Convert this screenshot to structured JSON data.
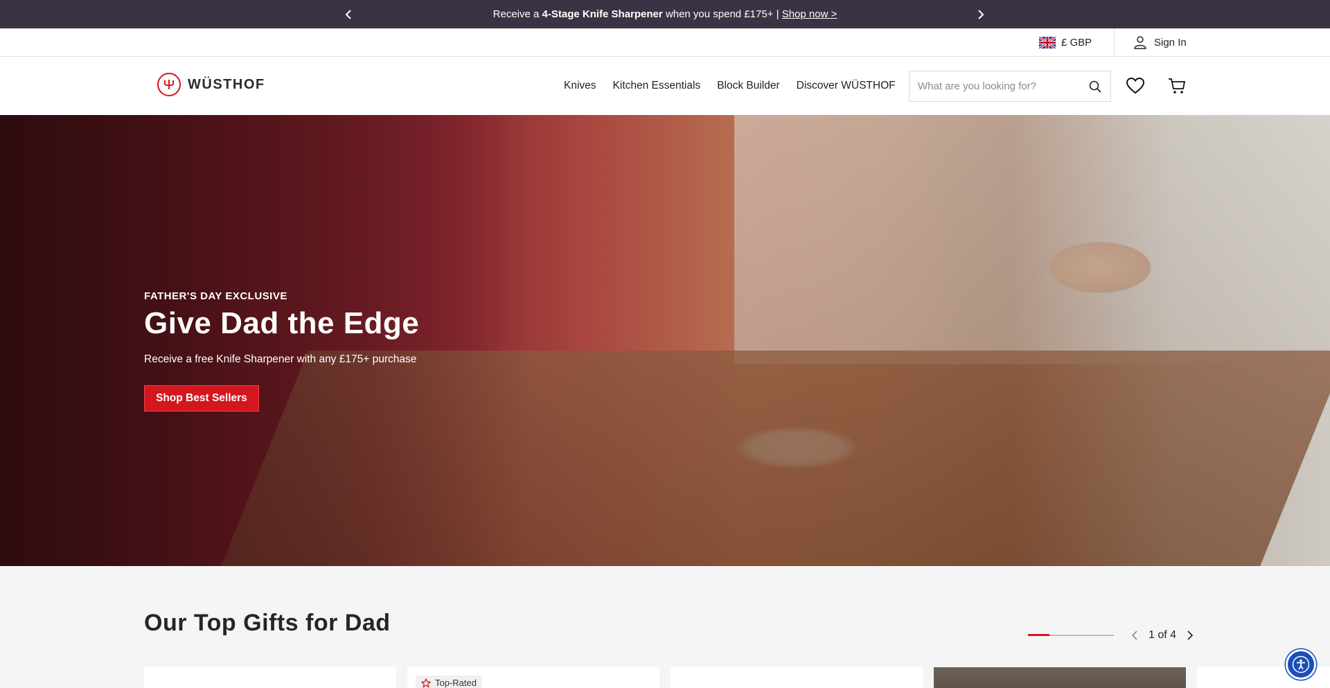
{
  "promo": {
    "text_prefix": "Receive a ",
    "text_bold": "4-Stage Knife Sharpener",
    "text_suffix": " when you spend £175+ | ",
    "link": "Shop now >"
  },
  "utility": {
    "currency": "£ GBP",
    "signin": "Sign In"
  },
  "header": {
    "logo_text": "WÜSTHOF",
    "nav": [
      "Knives",
      "Kitchen Essentials",
      "Block Builder",
      "Discover WÜSTHOF"
    ],
    "search_placeholder": "What are you looking for?"
  },
  "hero": {
    "eyebrow": "FATHER'S DAY EXCLUSIVE",
    "title": "Give Dad the Edge",
    "subtitle": "Receive a free Knife Sharpener with any £175+ purchase",
    "cta": "Shop Best Sellers"
  },
  "gifts": {
    "title": "Our Top Gifts for Dad",
    "pager_text": "1 of 4",
    "progress_fraction": 0.25,
    "badge": "Top-Rated"
  },
  "colors": {
    "brand_red": "#d4161f",
    "promo_bg": "#3b3343",
    "a11y_blue": "#1a4fb8"
  }
}
